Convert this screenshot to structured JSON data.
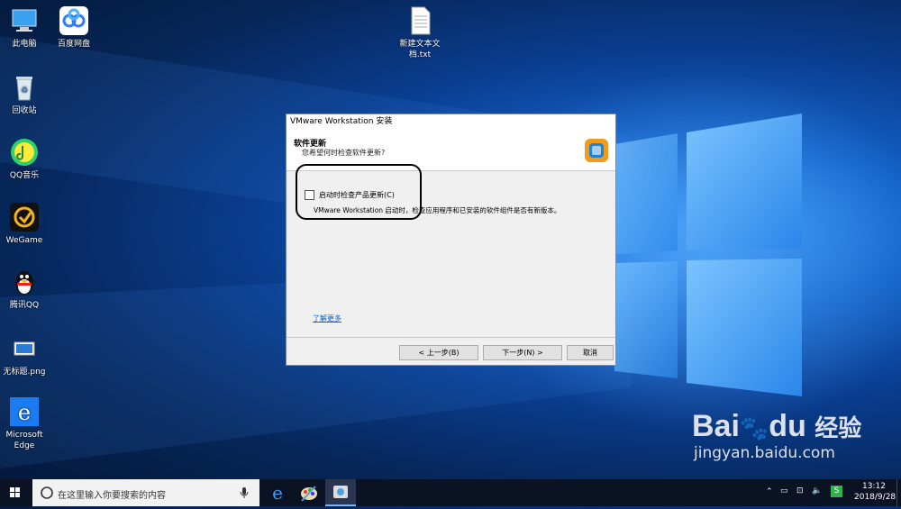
{
  "desktop": {
    "icons": [
      {
        "label": "此电脑"
      },
      {
        "label": "百度网盘"
      },
      {
        "label": "新建文本文档.txt",
        "line1": "新建文本文",
        "line2": "档.txt"
      },
      {
        "label": "回收站"
      },
      {
        "label": "QQ音乐"
      },
      {
        "label": "WeGame"
      },
      {
        "label": "腾讯QQ"
      },
      {
        "label": "无标题.png"
      },
      {
        "label": "Microsoft Edge",
        "line1": "Microsoft",
        "line2": "Edge"
      }
    ]
  },
  "installer": {
    "title": "VMware Workstation 安装",
    "header_title": "软件更新",
    "header_subtitle": "您希望何时检查软件更新?",
    "checkbox_label": "启动时检查产品更新(C)",
    "checkbox_checked": false,
    "description": "VMware Workstation 启动时，检查应用程序和已安装的软件组件是否有新版本。",
    "learn_more": "了解更多",
    "back_button": "< 上一步(B)",
    "next_button": "下一步(N) >",
    "cancel_button": "取消"
  },
  "taskbar": {
    "search_placeholder": "在这里输入你要搜索的内容",
    "time": "13:12",
    "date": "2018/9/28"
  },
  "watermark": {
    "brand": "Bai",
    "brand2": "du",
    "cn": "经验",
    "url": "jingyan.baidu.com"
  },
  "colors": {
    "accent": "#1a7cf0",
    "link": "#0066cc"
  }
}
